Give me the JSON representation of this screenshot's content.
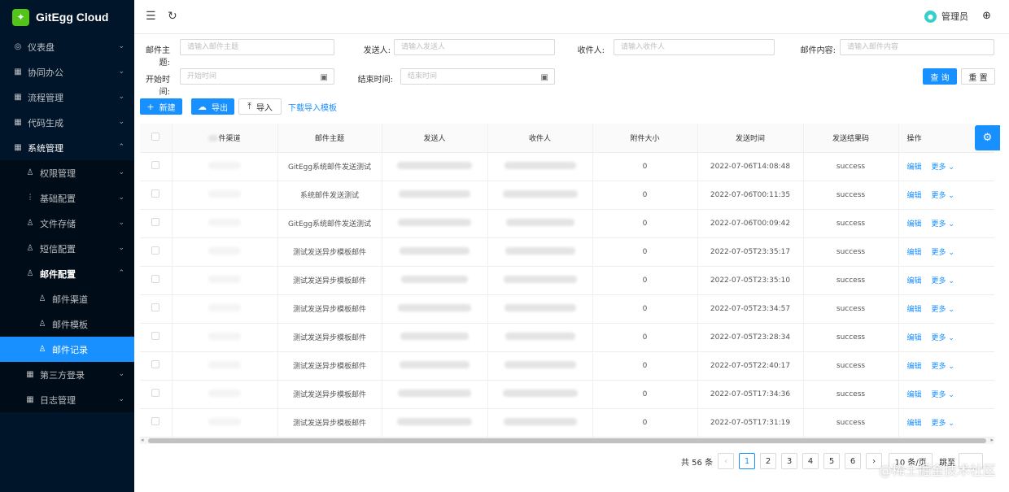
{
  "app": {
    "title": "GitEgg Cloud"
  },
  "sidebar": {
    "items": [
      {
        "label": "仪表盘",
        "icon": "dashboard-icon"
      },
      {
        "label": "协同办公",
        "icon": "office-icon"
      },
      {
        "label": "流程管理",
        "icon": "flow-icon"
      },
      {
        "label": "代码生成",
        "icon": "code-icon"
      },
      {
        "label": "系统管理",
        "icon": "system-icon"
      }
    ],
    "system_children": [
      {
        "label": "权限管理"
      },
      {
        "label": "基础配置"
      },
      {
        "label": "文件存储"
      },
      {
        "label": "短信配置"
      },
      {
        "label": "邮件配置"
      }
    ],
    "mail_children": [
      {
        "label": "邮件渠道"
      },
      {
        "label": "邮件模板"
      },
      {
        "label": "邮件记录"
      }
    ],
    "after": [
      {
        "label": "第三方登录"
      },
      {
        "label": "日志管理"
      }
    ]
  },
  "header": {
    "user_name": "管理员"
  },
  "search": {
    "subject_label": "邮件主题:",
    "subject_placeholder": "请输入邮件主题",
    "sender_label": "发送人:",
    "sender_placeholder": "请输入发送人",
    "receiver_label": "收件人:",
    "receiver_placeholder": "请输入收件人",
    "content_label": "邮件内容:",
    "content_placeholder": "请输入邮件内容",
    "start_label": "开始时间:",
    "start_placeholder": "开始时间",
    "end_label": "结束时间:",
    "end_placeholder": "结束时间",
    "query_button": "查 询",
    "reset_button": "重 置"
  },
  "toolbar": {
    "new_button": "新建",
    "export_button": "导出",
    "import_button": "导入",
    "download_template": "下载导入模板"
  },
  "table": {
    "columns": [
      "",
      "件渠道",
      "邮件主题",
      "发送人",
      "收件人",
      "附件大小",
      "发送时间",
      "发送结果码",
      "操作"
    ],
    "rows": [
      {
        "subject": "GitEgg系统邮件发送测试",
        "size": "0",
        "time": "2022-07-06T14:08:48",
        "result": "success"
      },
      {
        "subject": "系统邮件发送测试",
        "size": "0",
        "time": "2022-07-06T00:11:35",
        "result": "success"
      },
      {
        "subject": "GitEgg系统邮件发送测试",
        "size": "0",
        "time": "2022-07-06T00:09:42",
        "result": "success"
      },
      {
        "subject": "测试发送异步模板邮件",
        "size": "0",
        "time": "2022-07-05T23:35:17",
        "result": "success"
      },
      {
        "subject": "测试发送异步模板邮件",
        "size": "0",
        "time": "2022-07-05T23:35:10",
        "result": "success"
      },
      {
        "subject": "测试发送异步模板邮件",
        "size": "0",
        "time": "2022-07-05T23:34:57",
        "result": "success"
      },
      {
        "subject": "测试发送异步模板邮件",
        "size": "0",
        "time": "2022-07-05T23:28:34",
        "result": "success"
      },
      {
        "subject": "测试发送异步模板邮件",
        "size": "0",
        "time": "2022-07-05T22:40:17",
        "result": "success"
      },
      {
        "subject": "测试发送异步模板邮件",
        "size": "0",
        "time": "2022-07-05T17:34:36",
        "result": "success"
      },
      {
        "subject": "测试发送异步模板邮件",
        "size": "0",
        "time": "2022-07-05T17:31:19",
        "result": "success"
      }
    ],
    "edit_label": "编辑",
    "more_label": "更多"
  },
  "pagination": {
    "total": "共 56 条",
    "pages": [
      "1",
      "2",
      "3",
      "4",
      "5",
      "6"
    ],
    "current": "1",
    "page_size": "10 条/页",
    "jump_label": "跳至"
  },
  "watermark": "@稀土掘金技术社区",
  "colors": {
    "primary": "#1890ff",
    "sidebar": "#001529"
  }
}
